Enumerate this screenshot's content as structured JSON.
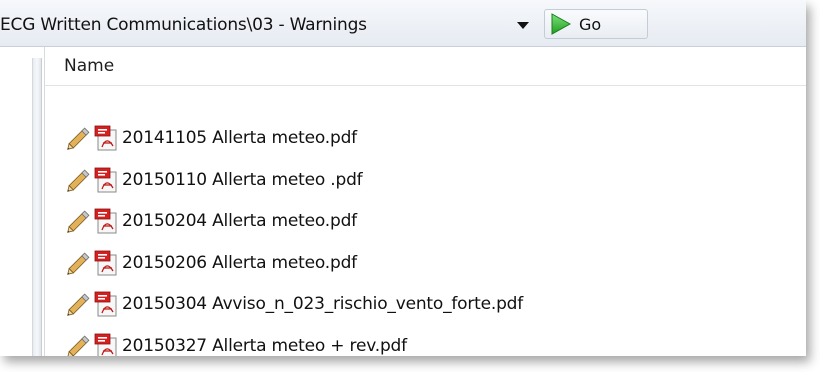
{
  "toolbar": {
    "path": "ECG Written Communications\\03 - Warnings",
    "go_label": "Go"
  },
  "list": {
    "column_header": "Name",
    "items": [
      {
        "label": "20141105 Allerta meteo.pdf"
      },
      {
        "label": "20150110 Allerta meteo .pdf"
      },
      {
        "label": "20150204 Allerta meteo.pdf"
      },
      {
        "label": "20150206 Allerta meteo.pdf"
      },
      {
        "label": "20150304 Avviso_n_023_rischio_vento_forte.pdf"
      },
      {
        "label": "20150327 Allerta meteo + rev.pdf"
      }
    ]
  },
  "icons": {
    "go": "play-arrow-icon",
    "edit": "pencil-icon",
    "file": "pdf-file-icon"
  },
  "colors": {
    "go_green": "#2eb82e",
    "pdf_red": "#d02020"
  }
}
